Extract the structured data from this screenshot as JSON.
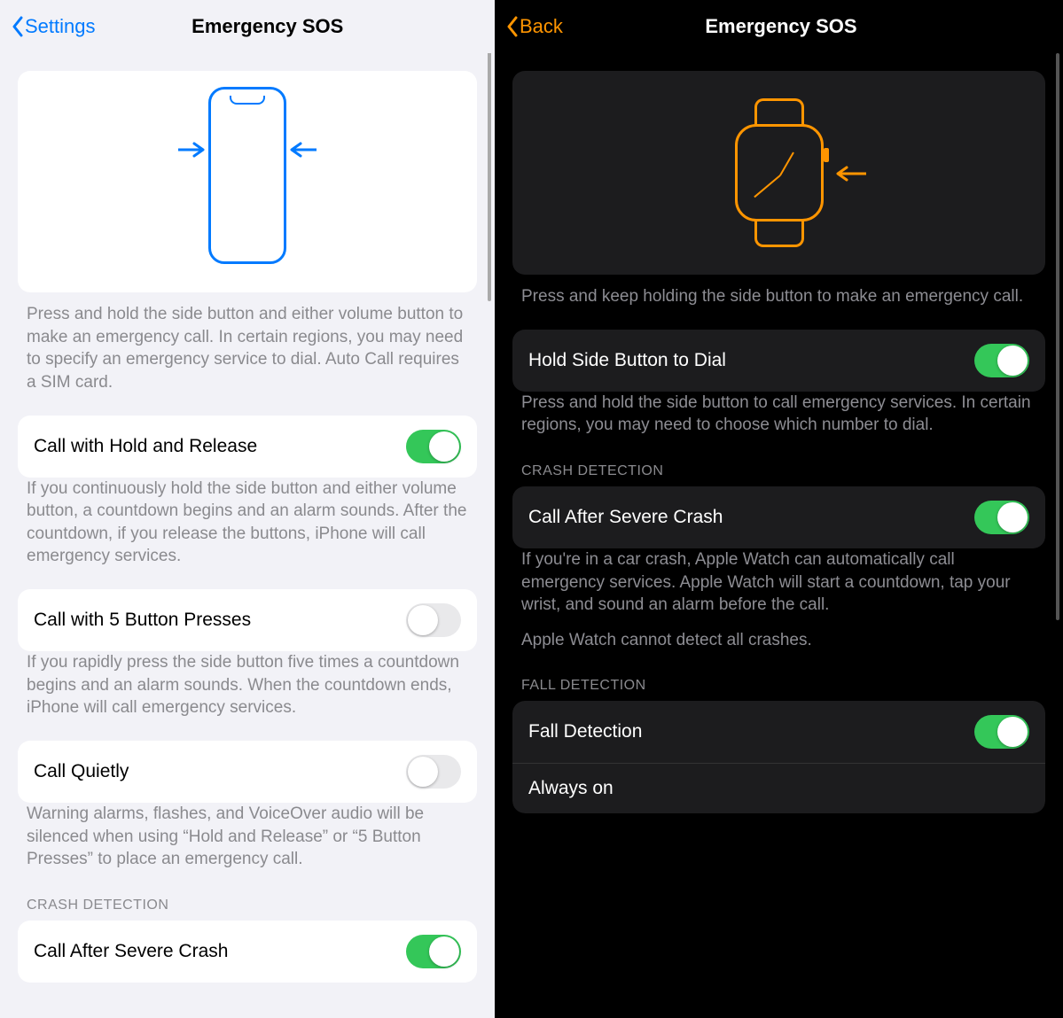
{
  "left": {
    "nav_back": "Settings",
    "nav_title": "Emergency SOS",
    "hero_desc": "Press and hold the side button and either volume button to make an emergency call. In certain regions, you may need to specify an emergency service to dial. Auto Call requires a SIM card.",
    "rows": {
      "hold_release": {
        "label": "Call with Hold and Release",
        "on": true,
        "desc": "If you continuously hold the side button and either volume button, a countdown begins and an alarm sounds. After the countdown, if you release the buttons, iPhone will call emergency services."
      },
      "five_press": {
        "label": "Call with 5 Button Presses",
        "on": false,
        "desc": "If you rapidly press the side button five times a countdown begins and an alarm sounds. When the countdown ends, iPhone will call emergency services."
      },
      "call_quietly": {
        "label": "Call Quietly",
        "on": false,
        "desc": "Warning alarms, flashes, and VoiceOver audio will be silenced when using “Hold and Release” or “5 Button Presses” to place an emergency call."
      },
      "crash_header": "CRASH DETECTION",
      "crash": {
        "label": "Call After Severe Crash",
        "on": true
      }
    }
  },
  "right": {
    "nav_back": "Back",
    "nav_title": "Emergency SOS",
    "hero_desc": "Press and keep holding the side button to make an emergency call.",
    "rows": {
      "hold_dial": {
        "label": "Hold Side Button to Dial",
        "on": true,
        "desc": "Press and hold the side button to call emergency services. In certain regions, you may need to choose which number to dial."
      },
      "crash_header": "CRASH DETECTION",
      "crash": {
        "label": "Call After Severe Crash",
        "on": true,
        "desc": "If you're in a car crash, Apple Watch can automatically call emergency services. Apple Watch will start a countdown, tap your wrist, and sound an alarm before the call.",
        "desc2": "Apple Watch cannot detect all crashes."
      },
      "fall_header": "FALL DETECTION",
      "fall": {
        "label": "Fall Detection",
        "on": true
      },
      "always_on": {
        "label": "Always on"
      }
    }
  }
}
